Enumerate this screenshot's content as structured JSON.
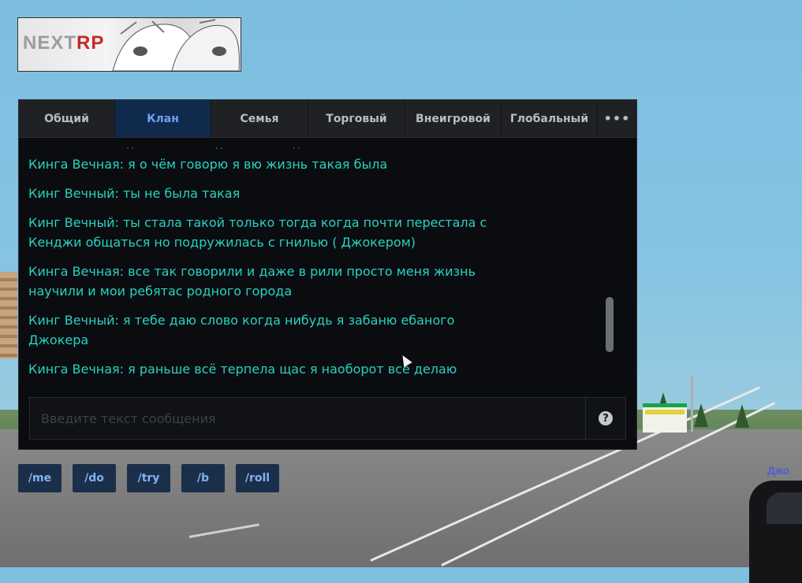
{
  "logo": {
    "text_main": "NEXT",
    "text_accent": "RP"
  },
  "chat": {
    "tabs": [
      {
        "label": "Общий",
        "active": false
      },
      {
        "label": "Клан",
        "active": true
      },
      {
        "label": "Семья",
        "active": false
      },
      {
        "label": "Торговый",
        "active": false
      },
      {
        "label": "Внеигровой",
        "active": false
      },
      {
        "label": "Глобальный",
        "active": false
      }
    ],
    "more_label": "•••",
    "messages": [
      "Кинга Вечная: я о чём говорю я вю жизнь такая была",
      "Кинг Вечный: ты не была такая",
      "Кинг Вечный: ты стала такой только тогда когда почти перестала с Кенджи общаться но подружилась с гнилью ( Джокером)",
      "Кинга Вечная: все так говорили и даже в рили просто меня жизнь научили и мои ребятас родного города",
      "Кинг Вечный: я тебе даю слово когда нибудь я забаню ебаного Джокера",
      "Кинга Вечная: я раньше всё терпела щас я наоборот всё делаю"
    ],
    "input": {
      "placeholder": "Введите текст сообщения",
      "value": ""
    },
    "help_label": "?"
  },
  "quick_commands": [
    "/me",
    "/do",
    "/try",
    "/b",
    "/roll"
  ],
  "world": {
    "player_tag": "Джо"
  },
  "colors": {
    "message_text": "#26d3c4",
    "active_tab_bg": "#102a4d",
    "active_tab_text": "#6aa3f0"
  }
}
